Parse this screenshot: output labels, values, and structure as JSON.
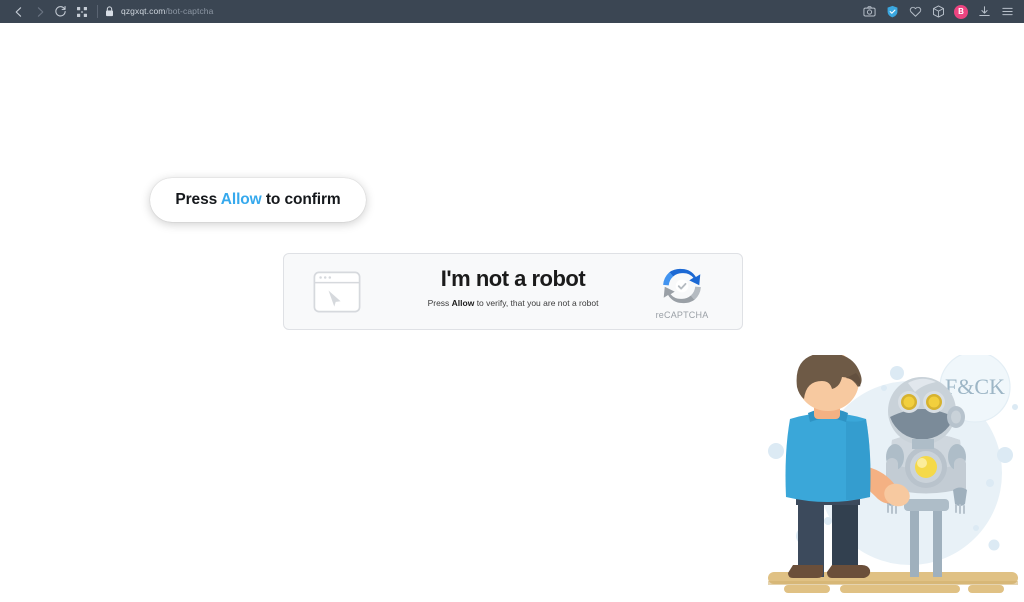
{
  "browser": {
    "url_host": "qzgxqt.com",
    "url_path": "/bot-captcha",
    "icons": {
      "back": "back-arrow-icon",
      "forward": "forward-arrow-icon",
      "reload": "reload-icon",
      "apps": "grid-apps-icon",
      "lock": "lock-icon",
      "screenshot": "camera-icon",
      "shield": "shield-icon",
      "heart": "heart-icon",
      "extensions": "extensions-icon",
      "download": "download-icon",
      "menu": "hamburger-menu-icon"
    },
    "avatar_initial": "B",
    "colors": {
      "bar_background": "#3b4653",
      "avatar_background": "#ec4480",
      "shield_accent": "#3aa7e0",
      "url_host_text": "#cfd6de",
      "url_path_text": "#8d97a4"
    }
  },
  "tooltip": {
    "prefix": "Press ",
    "accent": "Allow",
    "suffix": " to confirm",
    "accent_color": "#36a9ed"
  },
  "captcha": {
    "heading": "I'm not a robot",
    "sub_prefix": "Press ",
    "sub_bold": "Allow",
    "sub_suffix": " to verify, that you are not a robot",
    "logo_label": "reCAPTCHA",
    "window_icon": "browser-window-cursor-icon",
    "logo_icon": "recaptcha-arrows-icon",
    "colors": {
      "card_background": "#f8f9fa",
      "card_border": "#dfe1e5",
      "logo_blue": "#1c69d4",
      "logo_blue_light": "#4294f0",
      "logo_gray": "#9aa0a6",
      "label_gray": "#9aa0a6"
    }
  },
  "illustration": {
    "name": "man-with-robot-illustration",
    "speech_bubble_text": "F&CK",
    "parts": {
      "backdrop_circle": "backdrop-circle",
      "man": "man-figure-back-view",
      "robot": "robot-figure",
      "platform": "wooden-platform",
      "bubbles": "decorative-bubbles"
    },
    "colors": {
      "backdrop": "#e8f1f7",
      "bubble_fill": "#dceaf4",
      "hair": "#6e5a46",
      "skin": "#f4b183",
      "skin_light": "#f7c9a0",
      "shirt": "#3aa7d9",
      "shirt_dark": "#2e93c4",
      "jeans": "#3c4a5c",
      "jeans_dark": "#32404f",
      "shoes": "#6b4f3a",
      "robot_body": "#c3ccd4",
      "robot_body_light": "#d6dee4",
      "robot_face": "#7b8b99",
      "robot_limb": "#9fb0bd",
      "robot_eye": "#f2cf3d",
      "robot_eye_dark": "#d6b22f",
      "robot_core": "#f5d949",
      "platform": "#e0c184",
      "platform_dark": "#cfae6e",
      "speech_text": "#9db6c6"
    }
  }
}
